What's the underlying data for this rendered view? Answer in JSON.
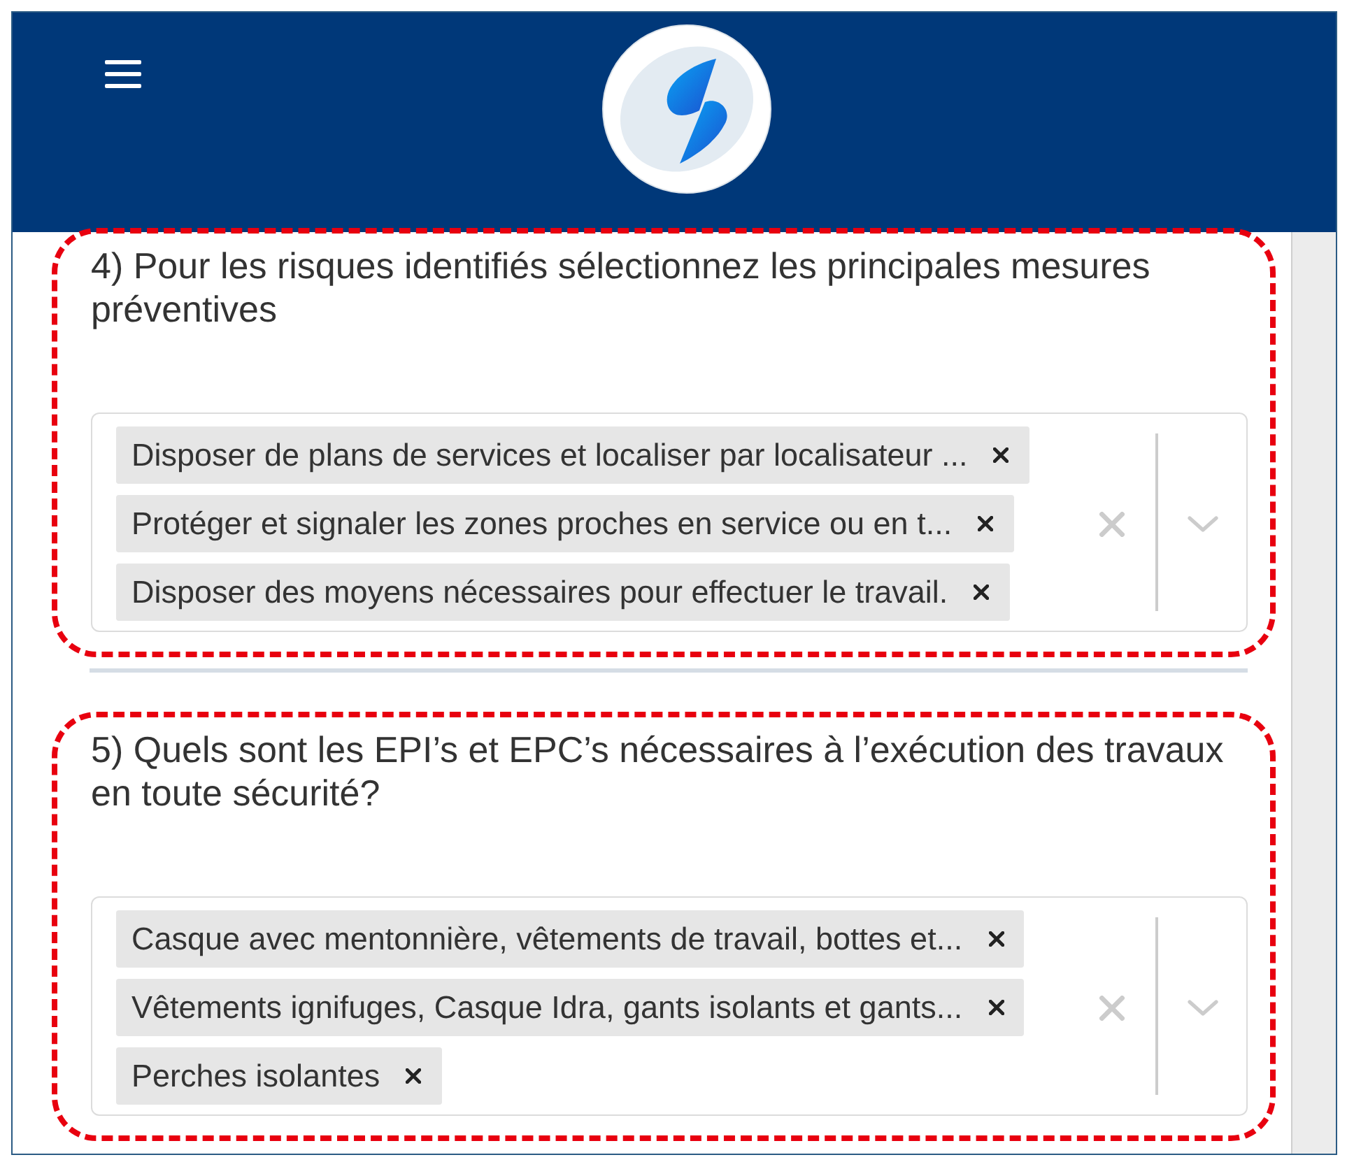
{
  "questions": [
    {
      "title": "4) Pour les risques identifiés sélectionnez les principales mesures préventives",
      "highlighted": true,
      "selected_options": [
        {
          "label": "Disposer de plans de services et localiser par localisateur ..."
        },
        {
          "label": "Protéger et signaler les zones proches en service ou en t..."
        },
        {
          "label": "Disposer des moyens nécessaires pour effectuer le travail."
        }
      ]
    },
    {
      "title": "5) Quels sont les EPI’s et EPC’s nécessaires à l’exécution des travaux en toute sécurité?",
      "highlighted": true,
      "selected_options": [
        {
          "label": "Casque avec mentonnière, vêtements de travail, bottes et..."
        },
        {
          "label": "Vêtements ignifuges, Casque Idra, gants isolants et gants..."
        },
        {
          "label": "Perches isolantes"
        }
      ]
    }
  ]
}
